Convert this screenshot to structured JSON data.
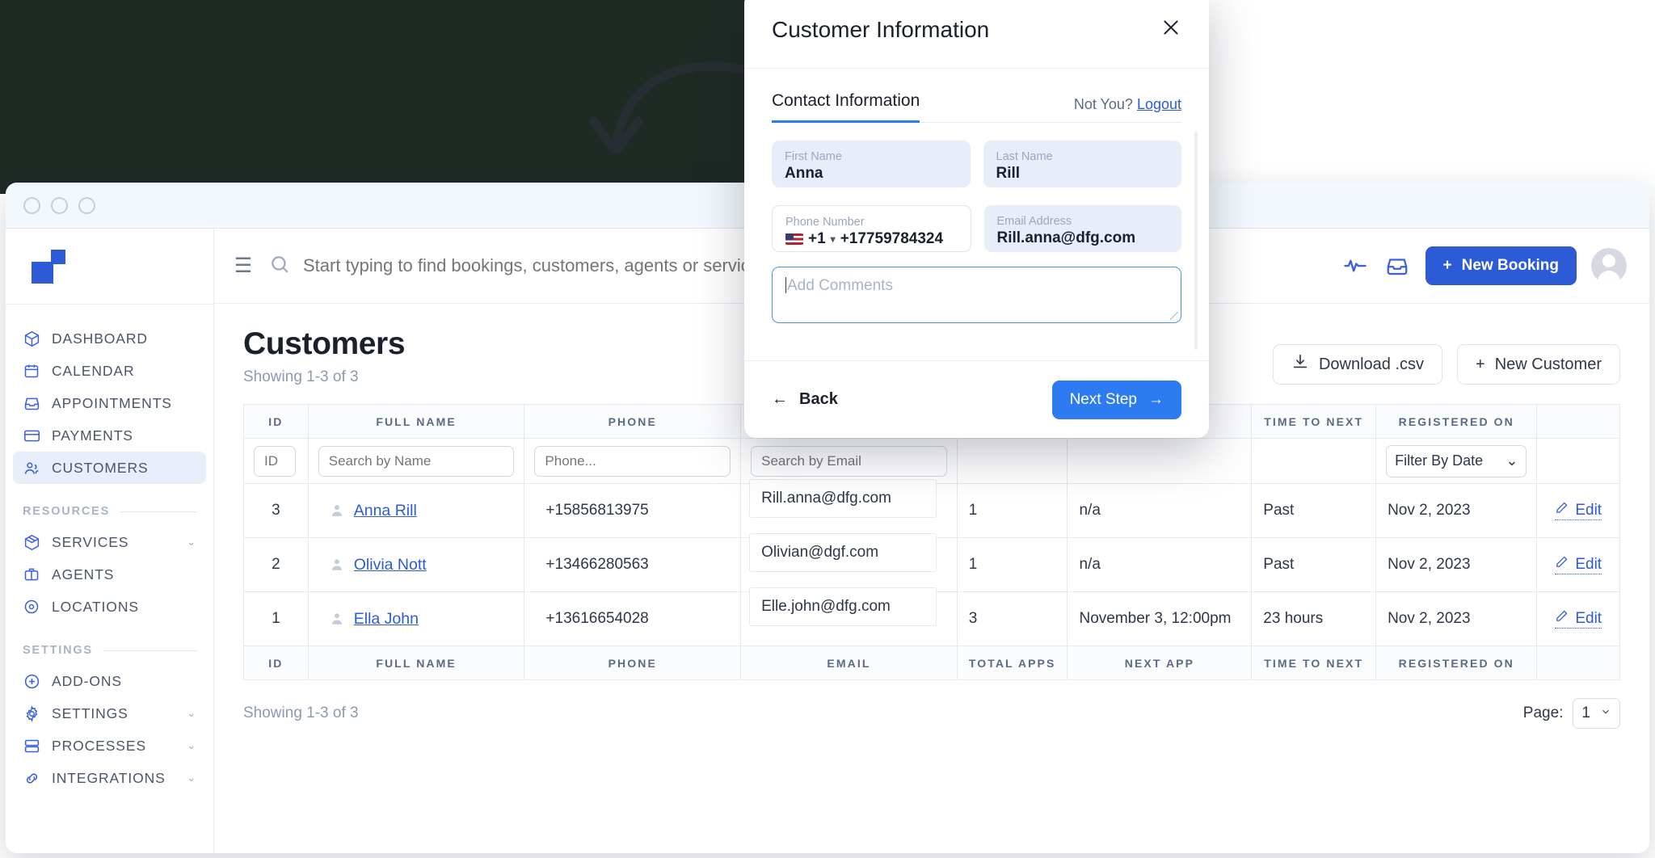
{
  "window": {
    "dots": [
      "dot-1",
      "dot-2",
      "dot-3"
    ]
  },
  "sidebar": {
    "logo_name": "app-logo",
    "items": [
      {
        "label": "DASHBOARD",
        "icon": "cube-icon",
        "active": false,
        "chevron": ""
      },
      {
        "label": "CALENDAR",
        "icon": "calendar-icon",
        "active": false,
        "chevron": ""
      },
      {
        "label": "APPOINTMENTS",
        "icon": "inbox-icon",
        "active": false,
        "chevron": ""
      },
      {
        "label": "PAYMENTS",
        "icon": "card-icon",
        "active": false,
        "chevron": ""
      },
      {
        "label": "CUSTOMERS",
        "icon": "users-icon",
        "active": true,
        "chevron": ""
      }
    ],
    "groups": [
      {
        "title": "RESOURCES",
        "items": [
          {
            "label": "SERVICES",
            "icon": "box-icon",
            "chevron": "⌄"
          },
          {
            "label": "AGENTS",
            "icon": "briefcase-icon",
            "chevron": ""
          },
          {
            "label": "LOCATIONS",
            "icon": "pin-icon",
            "chevron": ""
          }
        ]
      },
      {
        "title": "SETTINGS",
        "items": [
          {
            "label": "ADD-ONS",
            "icon": "plus-circle-icon",
            "chevron": ""
          },
          {
            "label": "SETTINGS",
            "icon": "gear-icon",
            "chevron": "⌄"
          },
          {
            "label": "PROCESSES",
            "icon": "server-icon",
            "chevron": "⌄"
          },
          {
            "label": "INTEGRATIONS",
            "icon": "link-icon",
            "chevron": "⌄"
          }
        ]
      }
    ]
  },
  "topbar": {
    "menu_icon": "hamburger-icon",
    "search_placeholder": "Start typing to find bookings, customers, agents or services",
    "search_value": "",
    "activity_icon": "pulse-icon",
    "inbox_icon": "inbox-icon",
    "new_booking_label": "New Booking",
    "new_booking_plus": "+"
  },
  "page": {
    "title": "Customers",
    "subtitle": "Showing 1-3 of 3",
    "download_label": "Download .csv",
    "new_customer_label": "New Customer",
    "new_customer_plus": "+",
    "footer_subtitle": "Showing 1-3 of 3",
    "pager_label": "Page:",
    "pager_value": "1"
  },
  "table": {
    "columns": [
      "ID",
      "FULL NAME",
      "PHONE",
      "EMAIL",
      "TOTAL APPS",
      "NEXT APP",
      "TIME TO NEXT",
      "REGISTERED ON",
      ""
    ],
    "filters": {
      "id_placeholder": "ID",
      "name_placeholder": "Search by Name",
      "phone_placeholder": "Phone...",
      "email_placeholder": "Search by Email",
      "date_filter_label": "Filter By Date",
      "date_filter_caret": "⌄"
    },
    "rows": [
      {
        "id": "3",
        "name": "Anna Rill",
        "phone": "+15856813975",
        "email": "Rill.anna@dfg.com",
        "total_apps": "1",
        "next_app": "n/a",
        "time_to_next": "Past",
        "time_state": "past",
        "registered_on": "Nov 2, 2023",
        "edit_label": "Edit"
      },
      {
        "id": "2",
        "name": "Olivia Nott",
        "phone": "+13466280563",
        "email": "Olivian@dgf.com",
        "total_apps": "1",
        "next_app": "n/a",
        "time_to_next": "Past",
        "time_state": "past",
        "registered_on": "Nov 2, 2023",
        "edit_label": "Edit"
      },
      {
        "id": "1",
        "name": "Ella John",
        "phone": "+13616654028",
        "email": "Elle.john@dfg.com",
        "total_apps": "3",
        "next_app": "November 3, 12:00pm",
        "time_to_next": "23 hours",
        "time_state": "soon",
        "registered_on": "Nov 2, 2023",
        "edit_label": "Edit"
      }
    ]
  },
  "modal": {
    "title": "Customer Information",
    "close_icon": "close-icon",
    "tab_label": "Contact Information",
    "not_you_text": "Not You?",
    "logout_label": "Logout",
    "fields": {
      "first_name_label": "First Name",
      "first_name_value": "Anna",
      "last_name_label": "Last Name",
      "last_name_value": "Rill",
      "phone_label": "Phone Number",
      "phone_country": "+1",
      "phone_caret": "▾",
      "phone_value": "+17759784324",
      "email_label": "Email Address",
      "email_value": "Rill.anna@dfg.com",
      "comments_placeholder": "Add Comments",
      "comments_value": ""
    },
    "back_label": "Back",
    "back_arrow": "←",
    "next_label": "Next Step",
    "next_arrow": "→"
  },
  "colors": {
    "brand_blue": "#2d5bd7",
    "accent_blue": "#2d7bf0",
    "danger": "#e0605f",
    "muted": "#8b9bb3",
    "backdrop": "#1f2a25"
  }
}
